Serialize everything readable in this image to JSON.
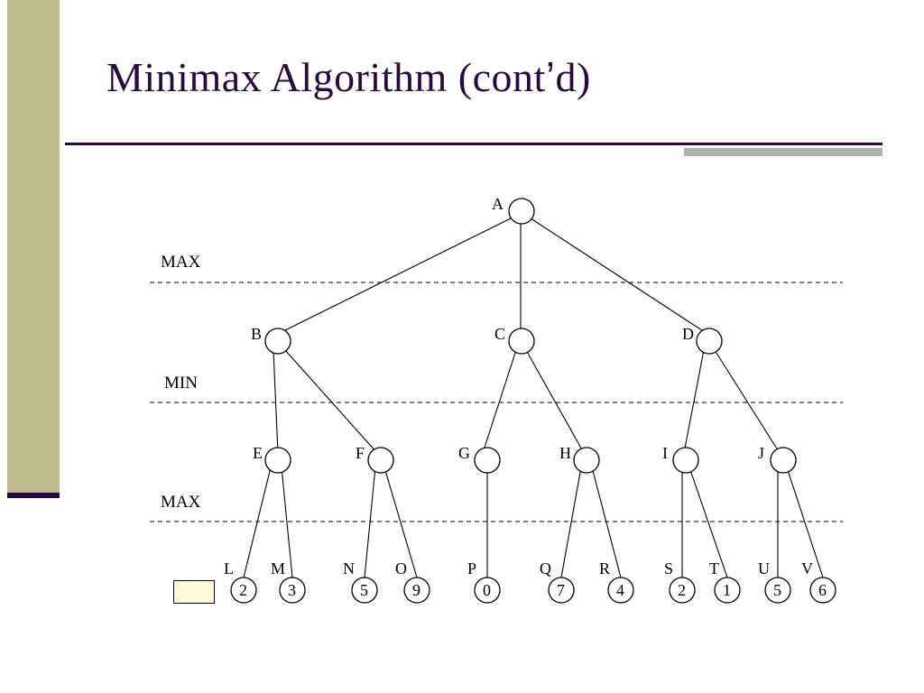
{
  "title": "Minimax Algorithm (cont'd)",
  "title_parts": {
    "before": "Minimax Algorithm (cont",
    "apos": "’",
    "after": "d)"
  },
  "levels": {
    "l1": "MAX",
    "l2": "MIN",
    "l3": "MAX"
  },
  "nodes": {
    "A": "A",
    "B": "B",
    "C": "C",
    "D": "D",
    "E": "E",
    "F": "F",
    "G": "G",
    "H": "H",
    "I": "I",
    "J": "J",
    "L": "L",
    "M": "M",
    "N": "N",
    "O": "O",
    "P": "P",
    "Q": "Q",
    "R": "R",
    "S": "S",
    "T": "T",
    "U": "U",
    "V": "V"
  },
  "leaf_values": {
    "L": "2",
    "M": "3",
    "N": "5",
    "O": "9",
    "P": "0",
    "Q": "7",
    "R": "4",
    "S": "2",
    "T": "1",
    "U": "5",
    "V": "6"
  },
  "tree": {
    "root": "A",
    "player_at_root": "MAX",
    "children": {
      "A": [
        "B",
        "C",
        "D"
      ],
      "B": [
        "E",
        "F"
      ],
      "C": [
        "G",
        "H"
      ],
      "D": [
        "I",
        "J"
      ],
      "E": [
        "L",
        "M"
      ],
      "F": [
        "N",
        "O"
      ],
      "G": [
        "P"
      ],
      "H": [
        "Q",
        "R"
      ],
      "I": [
        "S",
        "T"
      ],
      "J": [
        "U",
        "V"
      ]
    }
  }
}
